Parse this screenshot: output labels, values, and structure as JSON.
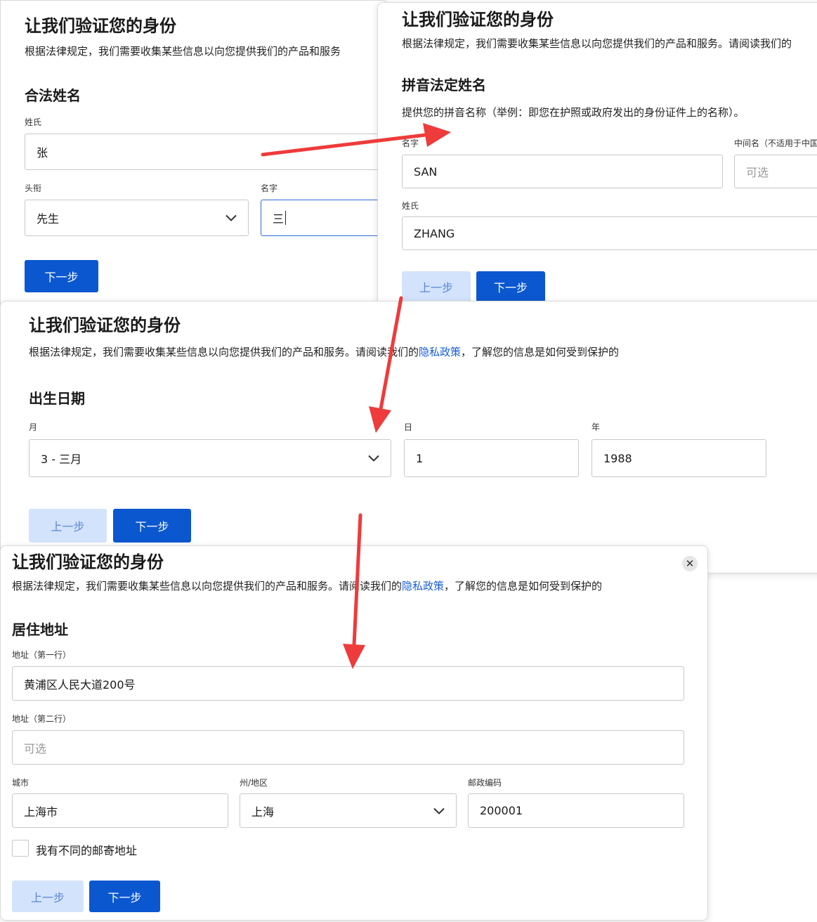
{
  "colors": {
    "primary": "#0b57d0",
    "secondary": "#d3e3fb",
    "link": "#1a5fd6",
    "arrow": "#ee3b3b"
  },
  "panel_legal_name": {
    "title": "让我们验证您的身份",
    "description": "根据法律规定，我们需要收集某些信息以向您提供我们的产品和服务",
    "section": "合法姓名",
    "surname_label": "姓氏",
    "surname_value": "张",
    "salutation_label": "头衔",
    "salutation_value": "先生",
    "given_name_label": "名字",
    "given_name_value": "三",
    "next_button": "下一步"
  },
  "panel_pinyin": {
    "title": "让我们验证您的身份",
    "description": "根据法律规定，我们需要收集某些信息以向您提供我们的产品和服务。请阅读我们的",
    "section": "拼音法定姓名",
    "hint": "提供您的拼音名称（举例：即您在护照或政府发出的身份证件上的名称）。",
    "given_name_label": "名字",
    "given_name_value": "SAN",
    "middle_name_label": "中间名（不适用于中国",
    "middle_name_placeholder": "可选",
    "surname_label": "姓氏",
    "surname_value": "ZHANG",
    "prev_button": "上一步",
    "next_button": "下一步"
  },
  "panel_birthdate": {
    "title": "让我们验证您的身份",
    "description_pre": "根据法律规定，我们需要收集某些信息以向您提供我们的产品和服务。请阅读我们的",
    "privacy_link": "隐私政策",
    "description_post": "，了解您的信息是如何受到保护的",
    "section": "出生日期",
    "month_label": "月",
    "month_value": "3 - 三月",
    "day_label": "日",
    "day_value": "1",
    "year_label": "年",
    "year_value": "1988",
    "prev_button": "上一步",
    "next_button": "下一步"
  },
  "panel_address": {
    "title": "让我们验证您的身份",
    "description_pre": "根据法律规定，我们需要收集某些信息以向您提供我们的产品和服务。请阅读我们的",
    "privacy_link": "隐私政策",
    "description_post": "，了解您的信息是如何受到保护的",
    "close_glyph": "✕",
    "section": "居住地址",
    "line1_label": "地址（第一行）",
    "line1_value": "黄浦区人民大道200号",
    "line2_label": "地址（第二行）",
    "line2_placeholder": "可选",
    "city_label": "城市",
    "city_value": "上海市",
    "state_label": "州/地区",
    "state_value": "上海",
    "postal_label": "邮政编码",
    "postal_value": "200001",
    "mailing_checkbox_label": "我有不同的邮寄地址",
    "prev_button": "上一步",
    "next_button": "下一步"
  }
}
